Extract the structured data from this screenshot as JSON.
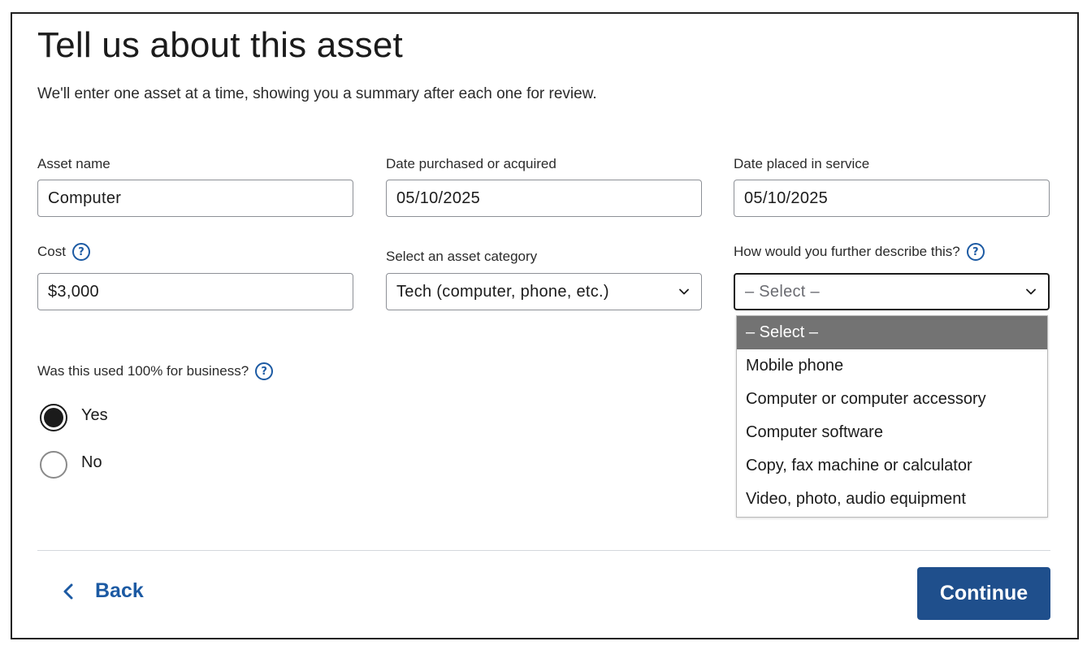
{
  "page": {
    "title": "Tell us about this asset",
    "subtitle": "We'll enter one asset at a time, showing you a summary after each one for review."
  },
  "fields": {
    "asset_name": {
      "label": "Asset name",
      "value": "Computer"
    },
    "date_purchased": {
      "label": "Date purchased or acquired",
      "value": "05/10/2025"
    },
    "date_placed": {
      "label": "Date placed in service",
      "value": "05/10/2025"
    },
    "cost": {
      "label": "Cost",
      "value": "$3,000"
    },
    "asset_category": {
      "label": "Select an asset category",
      "value": "Tech (computer, phone, etc.)"
    },
    "further_describe": {
      "label": "How would you further describe this?",
      "value": "– Select –"
    }
  },
  "dropdown": {
    "options": [
      "– Select –",
      "Mobile phone",
      "Computer or computer accessory",
      "Computer software",
      "Copy, fax machine or calculator",
      "Video, photo, audio equipment"
    ],
    "highlighted_index": 0
  },
  "business_use": {
    "question": "Was this used 100% for business?",
    "options": [
      {
        "label": "Yes",
        "checked": true
      },
      {
        "label": "No",
        "checked": false
      }
    ]
  },
  "help_icon_glyph": "?",
  "footer": {
    "back_label": "Back",
    "continue_label": "Continue"
  },
  "colors": {
    "accent": "#1c5aa3",
    "primary_button": "#1f4f8c",
    "highlight_option": "#737373"
  },
  "icons": [
    "help-icon",
    "chevron-down-icon",
    "chevron-left-icon",
    "radio-checked",
    "radio-unchecked"
  ]
}
